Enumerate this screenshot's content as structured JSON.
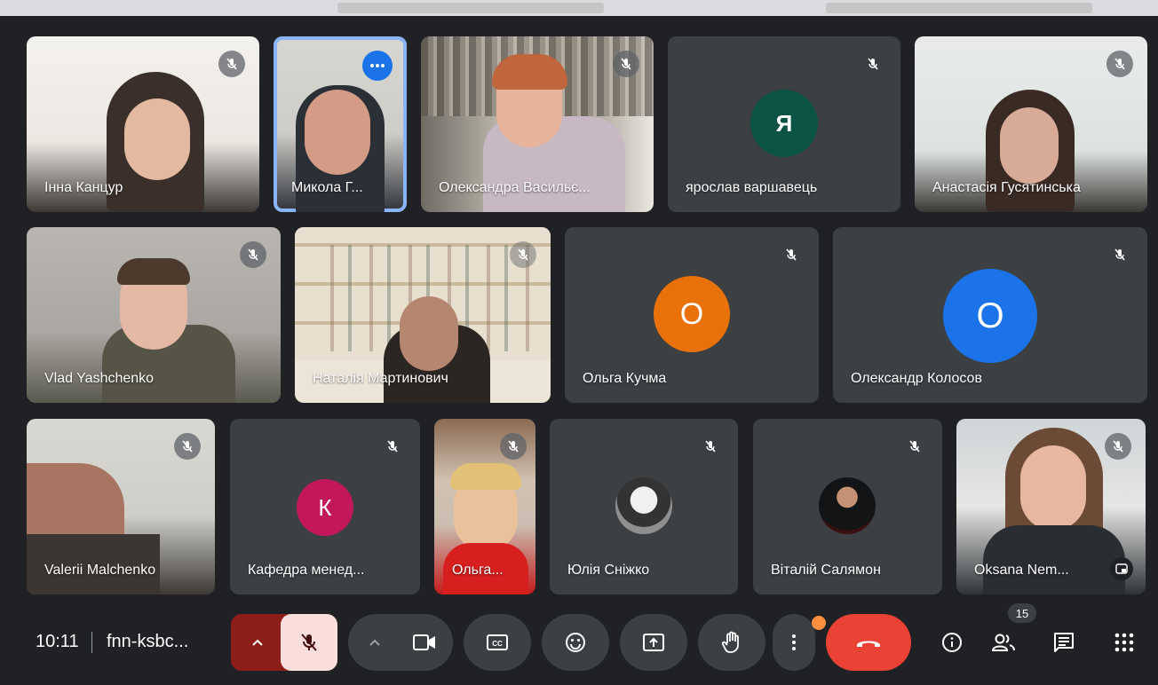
{
  "participants": [
    {
      "name": "Інна Канцур",
      "type": "video"
    },
    {
      "name": "Микола Г...",
      "type": "video",
      "selected": true
    },
    {
      "name": "Олександра Васильє...",
      "type": "video"
    },
    {
      "name": "ярослав варшавець",
      "type": "avatar",
      "initial": "Я",
      "color": "#0b5345"
    },
    {
      "name": "Анастасія Гусятинська",
      "type": "video"
    },
    {
      "name": "Vlad Yashchenko",
      "type": "video"
    },
    {
      "name": "Наталія Мартинович",
      "type": "video"
    },
    {
      "name": "Ольга Кучма",
      "type": "avatar",
      "initial": "О",
      "color": "#e8710a"
    },
    {
      "name": "Олександр Колосов",
      "type": "avatar",
      "initial": "О",
      "color": "#1a73e8"
    },
    {
      "name": "Valerii Malchenko",
      "type": "video"
    },
    {
      "name": "Кафедра менед...",
      "type": "avatar",
      "initial": "К",
      "color": "#c2185b"
    },
    {
      "name": "Ольга...",
      "type": "video"
    },
    {
      "name": "Юлія Сніжко",
      "type": "avatar-photo"
    },
    {
      "name": "Віталій Салямон",
      "type": "avatar-photo"
    },
    {
      "name": "Oksana Nem...",
      "type": "video"
    }
  ],
  "meeting": {
    "time": "10:11",
    "separator": "|",
    "code": "fnn-ksbc...",
    "participant_count": "15"
  },
  "colors": {
    "end_call": "#ea4335",
    "mic_off_bg": "#f9dedc",
    "mic_off_group": "#8c1d18",
    "accent": "#8ab4f8",
    "notification": "#fa903e"
  },
  "icons": [
    "mic-off-icon",
    "more-options-icon",
    "camera-icon",
    "captions-icon",
    "emoji-icon",
    "present-icon",
    "raise-hand-icon",
    "end-call-icon",
    "info-icon",
    "people-icon",
    "chat-icon",
    "activities-icon",
    "chevron-up-icon",
    "pip-icon"
  ]
}
